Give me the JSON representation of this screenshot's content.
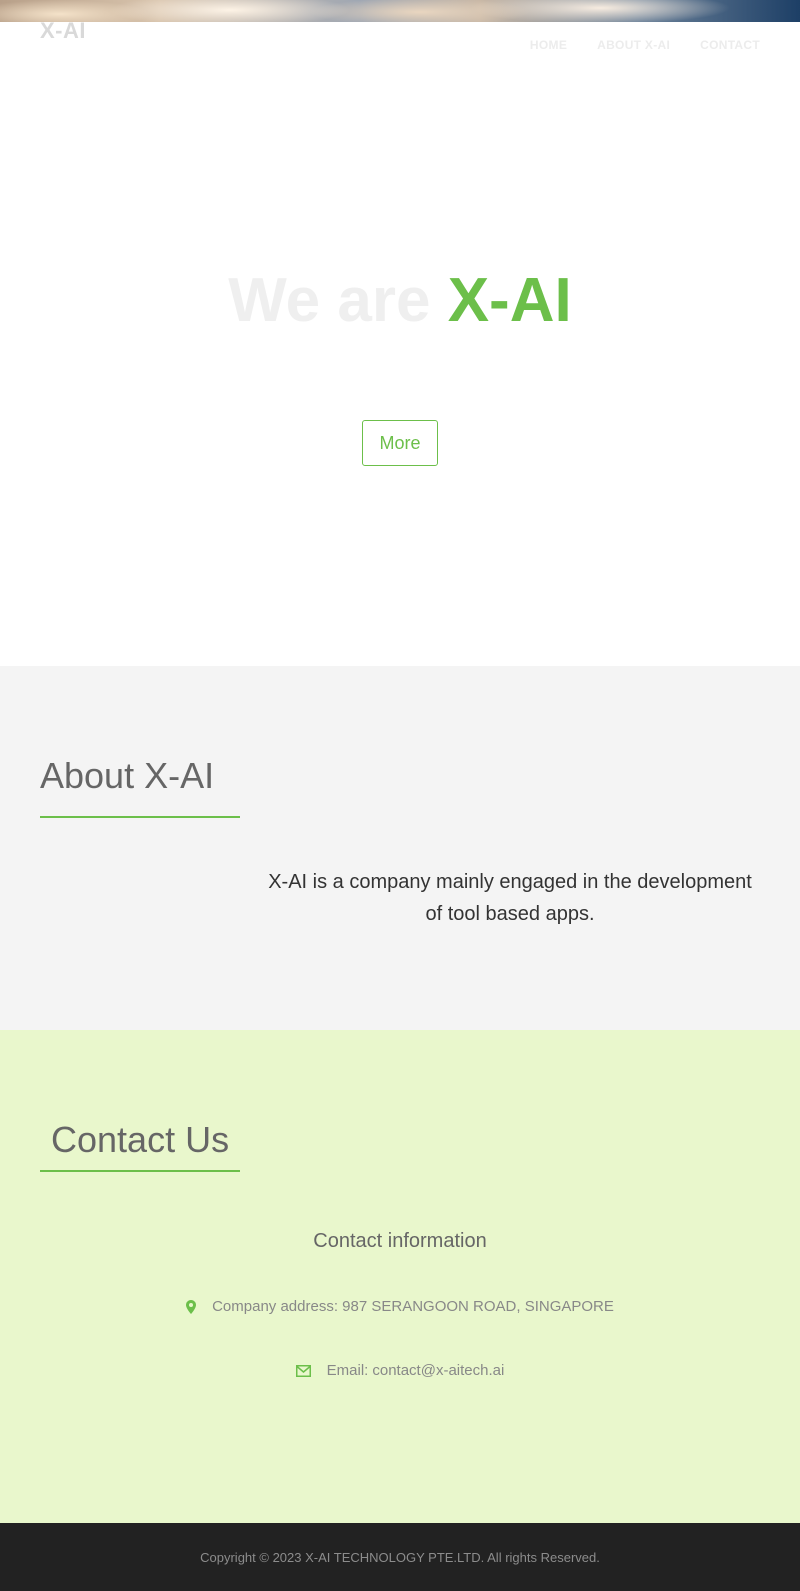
{
  "header": {
    "logo": "X-AI",
    "nav": [
      "HOME",
      "ABOUT X-AI",
      "CONTACT"
    ]
  },
  "hero": {
    "title_lead": "We are ",
    "title_brand": "X-AI",
    "button_label": "More"
  },
  "about": {
    "heading": "About X-AI",
    "text": "X-AI is a company mainly engaged in the development of tool based apps."
  },
  "contact": {
    "heading": "Contact Us",
    "subheading": "Contact information",
    "address": "Company address: 987 SERANGOON ROAD, SINGAPORE",
    "email_label": "Email:",
    "email_value": "contact@x-aitech.ai",
    "icons": {
      "address": "map-marker-icon",
      "email": "envelope-icon"
    }
  },
  "footer": {
    "copyright": "Copyright © 2023 X-AI TECHNOLOGY PTE.LTD. All rights Reserved."
  },
  "colors": {
    "accent": "#6cbf4a",
    "about_bg": "#f4f4f4",
    "contact_bg": "#e9f7cc",
    "footer_bg": "#222222"
  }
}
